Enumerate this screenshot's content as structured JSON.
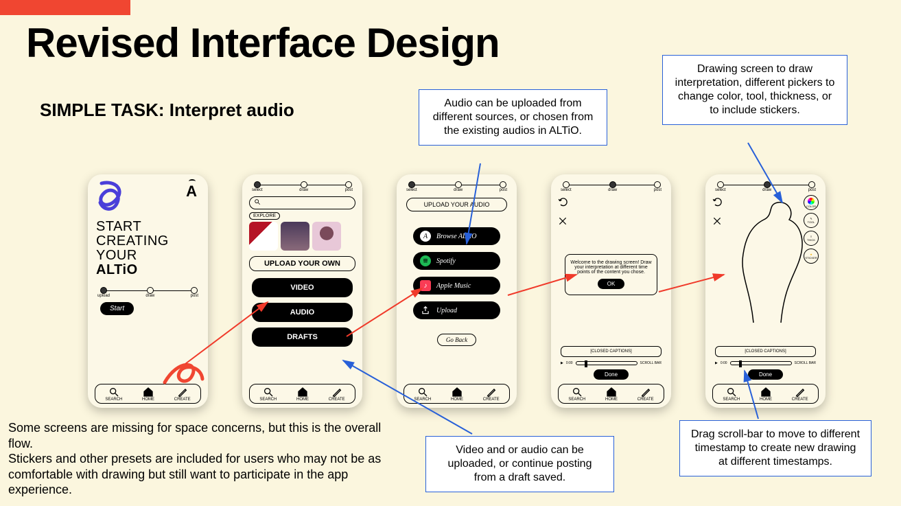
{
  "slide": {
    "title": "Revised Interface Design",
    "subtitle": "SIMPLE TASK: Interpret audio"
  },
  "progress_steps": [
    "select",
    "draw",
    "post"
  ],
  "progress_steps_p1": [
    "upload",
    "draw",
    "post"
  ],
  "nav": {
    "search": "SEARCH",
    "home": "HOME",
    "create": "CREATE"
  },
  "phone1": {
    "heading_l1": "START",
    "heading_l2": "CREATING",
    "heading_l3": "YOUR",
    "heading_bold": "ALTiO",
    "start": "Start"
  },
  "phone2": {
    "explore": "EXPLORE",
    "upload_own": "UPLOAD YOUR OWN",
    "video": "VIDEO",
    "audio": "AUDIO",
    "drafts": "DRAFTS"
  },
  "phone3": {
    "upload_audio": "UPLOAD YOUR AUDIO",
    "browse": "Browse ALTiO",
    "spotify": "Spotify",
    "apple": "Apple Music",
    "upload": "Upload",
    "go_back": "Go Back"
  },
  "phone4": {
    "modal_text": "Welcome to the drawing screen! Draw your interpretation at different time points of the content you chose.",
    "ok": "OK",
    "captions": "[CLOSED CAPTIONS]",
    "done": "Done",
    "scroll_label_l": "0:00",
    "scroll_label_r": "SCROLL BAR"
  },
  "phone5": {
    "captions": "[CLOSED CAPTIONS]",
    "done": "Done",
    "scroll_label_l": "0:00",
    "scroll_label_r": "SCROLL BAR",
    "tool_color": "COLOR",
    "tool_tool": "TOOL",
    "tool_thick": "THICK",
    "tool_sticker": "STICKER"
  },
  "callouts": {
    "c1": "Audio can be uploaded from different sources, or chosen from the existing audios in ALTiO.",
    "c2": "Drawing screen to draw interpretation, different pickers to change color, tool, thickness, or to include stickers.",
    "c3": "Video and or audio can be uploaded, or continue posting from a draft saved.",
    "c4": "Drag scroll-bar to move to different timestamp to create new drawing at different timestamps."
  },
  "footnote": {
    "l1": "Some screens are missing for space concerns, but this is the overall flow.",
    "l2": "Stickers and other presets are included for users who may not be as comfortable with drawing but still want to participate in the app experience."
  }
}
